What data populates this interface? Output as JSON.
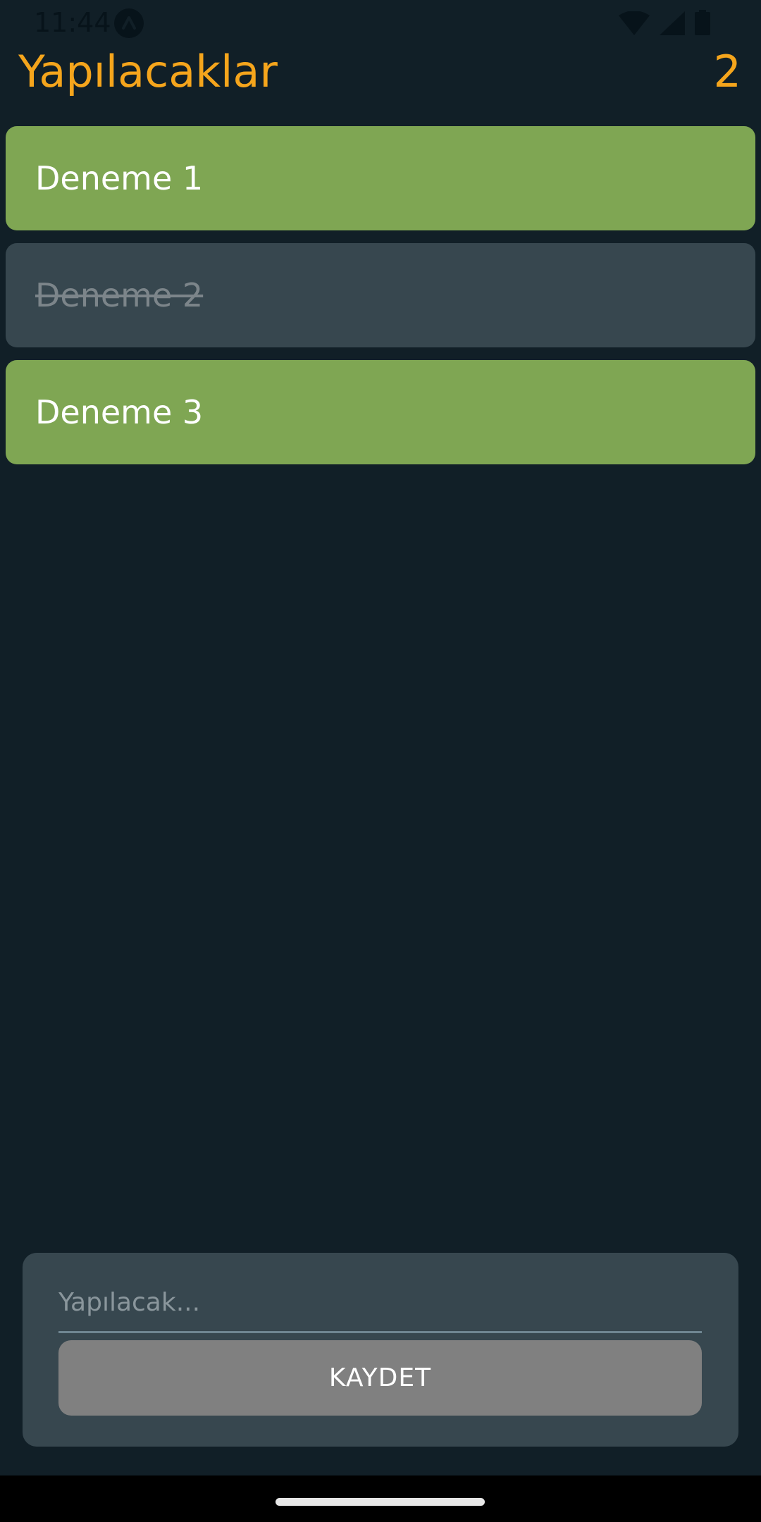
{
  "status_bar": {
    "time": "11:44",
    "icons": [
      "app-notification-icon",
      "wifi-icon",
      "signal-icon",
      "battery-icon"
    ]
  },
  "header": {
    "title": "Yapılacaklar",
    "count": "2"
  },
  "todos": [
    {
      "text": "Deneme 1",
      "done": false
    },
    {
      "text": "Deneme 2",
      "done": true
    },
    {
      "text": "Deneme 3",
      "done": false
    }
  ],
  "form": {
    "input_value": "",
    "input_placeholder": "Yapılacak...",
    "save_label": "KAYDET"
  },
  "colors": {
    "background": "#111f27",
    "accent": "#f5a51c",
    "item_active": "#7fa653",
    "item_done": "#37474f",
    "panel": "#37474f",
    "button": "#808080"
  }
}
